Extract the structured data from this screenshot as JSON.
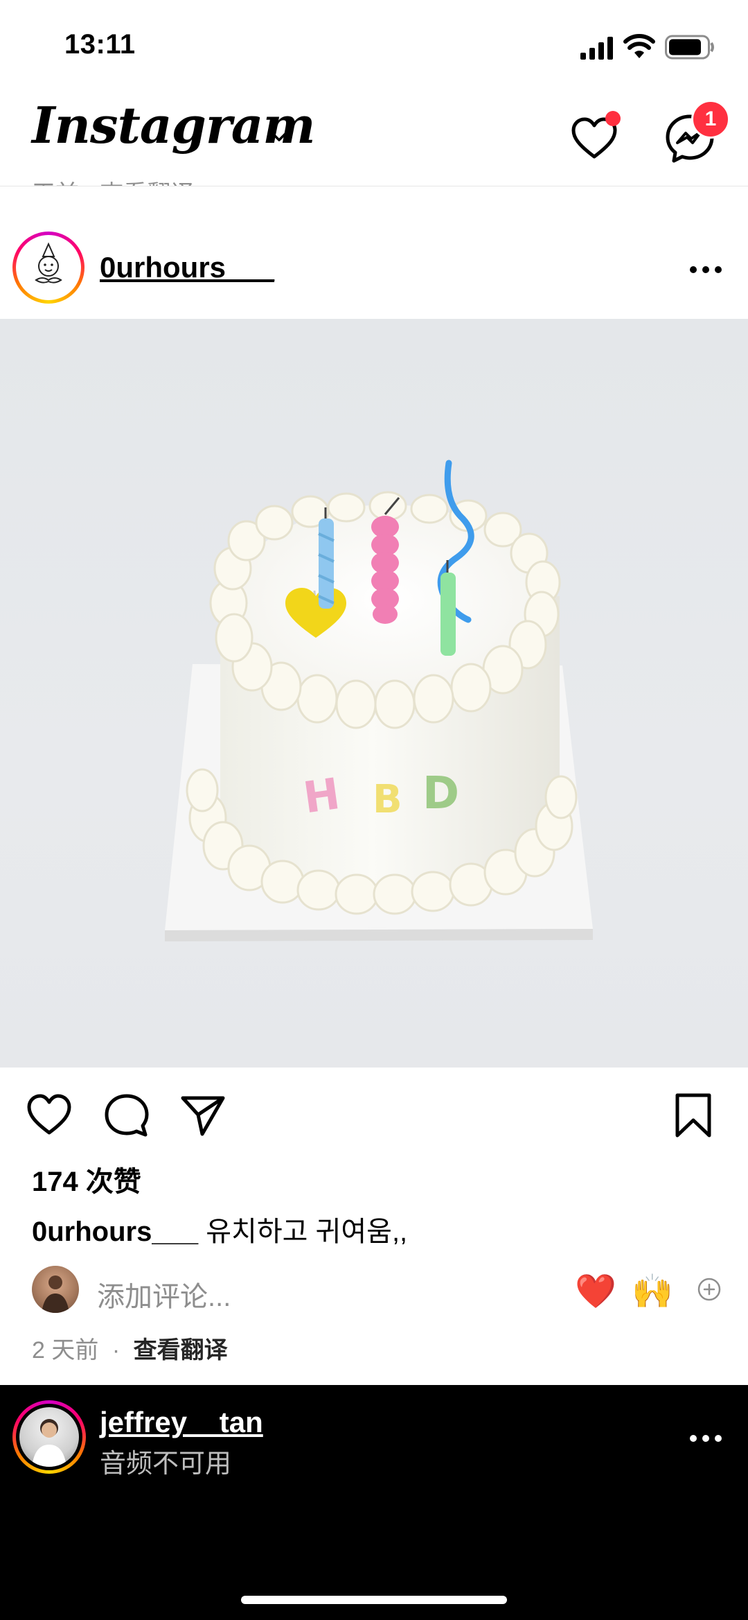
{
  "status_bar": {
    "time": "13:11"
  },
  "header": {
    "logo": "Instagram",
    "notification_count": "1"
  },
  "ghost_line": "天前 · 查看翻译",
  "post": {
    "username": "0urhours___",
    "likes": "174 次赞",
    "caption_user": "0urhours___",
    "caption_text": "유치하고 귀여움,,",
    "add_comment_placeholder": "添加评论...",
    "emoji_reactions": [
      "❤️",
      "🙌"
    ],
    "time_ago": "2 天前",
    "separator": "·",
    "translate": "查看翻译"
  },
  "next_post": {
    "username": "jeffrey__tan",
    "subtitle": "音频不可用"
  },
  "colors": {
    "accent_red": "#ff3040",
    "text_secondary": "#8e8e8e"
  }
}
